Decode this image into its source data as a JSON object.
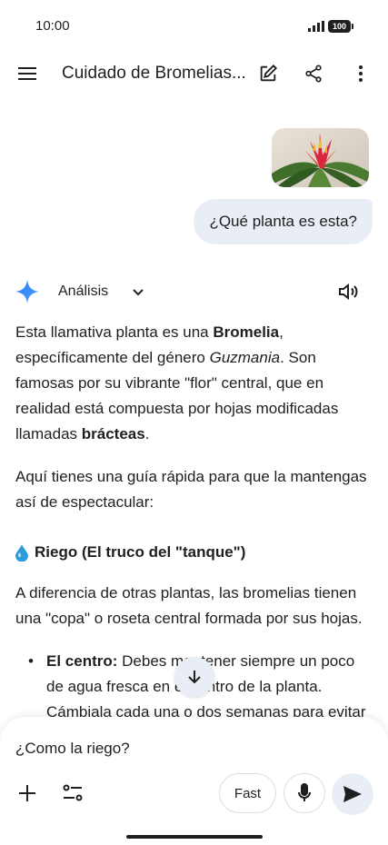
{
  "status_bar": {
    "time": "10:00",
    "battery": "100"
  },
  "top_bar": {
    "menu_icon": "hamburger-menu-icon",
    "title": "Cuidado de Bromelias...",
    "edit_icon": "edit-icon",
    "share_icon": "share-icon",
    "more_icon": "more-vert-icon"
  },
  "user_message": {
    "image": "bromeliad-photo",
    "text": "¿Qué planta es esta?"
  },
  "reply": {
    "mode_label": "Análisis",
    "intro": {
      "t1": "Esta llamativa planta es una ",
      "b1": "Bromelia",
      "t2": ", específicamente del género ",
      "i1": "Guzmania",
      "t3": ". Son famosas por su vibrante \"flor\" central, que en realidad está compuesta por hojas modificadas llamadas ",
      "b2": "brácteas",
      "t4": "."
    },
    "guide_text": "Aquí tienes una guía rápida para que la mantengas así de espectacular:",
    "section_title": "Riego (El truco del \"tanque\")",
    "section_text": "A diferencia de otras plantas, las bromelias tienen una \"copa\" o roseta central formada por sus hojas.",
    "bullet_1_label": "El centro:",
    "bullet_1_text": " Debes mantener siempre un poco de agua fresca en el centro de la planta. Cámbiala cada una o dos semanas para evitar"
  },
  "composer": {
    "input_text": "¿Como la riego?",
    "fast_label": "Fast"
  },
  "colors": {
    "accent": "#4285f4",
    "bubble": "#e9eef6",
    "text": "#1f1f1f"
  }
}
